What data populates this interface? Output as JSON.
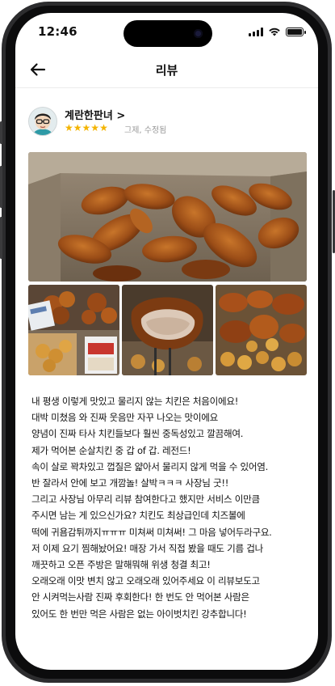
{
  "status_bar": {
    "time": "12:46"
  },
  "header": {
    "title": "리뷰",
    "back_icon": "arrow-left-icon"
  },
  "author": {
    "name": "계란한판녀 >",
    "rating": 5,
    "meta": "그제, 수정됨"
  },
  "photos": {
    "count": 4
  },
  "colors": {
    "star": "#f4b400",
    "text": "#111111",
    "muted": "#999999"
  },
  "review": {
    "lines": [
      "내 평생 이렇게 맛있고 물리지 않는 치킨은 처음이에요!",
      "대박 미쳤음 와 진짜 웃음만 자꾸 나오는 맛이에요",
      "양념이 진짜 타사 치킨들보다 훨씬 중독성있고 깔끔해여.",
      "제가 먹어본 순살치킨 중 갑 of 갑. 레전드!",
      "속이 살로 꽉차있고 껍질은 얇아서 물리지 않게 먹을 수 있어염.",
      "반 잘라서 안에 보고 개깜놀! 살박ㅋㅋㅋ 사장님 굿!!",
      "그리고 사장님 아무리 리뷰 참여한다고 했지만 서비스 이만큼",
      "주시면 남는 게 있으신가요? 치킨도 최상급인데 치즈볼에",
      "떡에 귀욤감튀까지ㅠㅠㅠ 미쳐써 미쳐써! 그 마음 넣어두라구요.",
      "저 이제 요기 찜해놨어요! 매장 가서 직접 봤을 때도 기름 겁나",
      "깨끗하고 오픈 주방은 말해뭐해 위생 청결 최고!",
      "오래오래 이맛 변치 않고 오래오래 있어주세요 이 리뷰보도고",
      "안 시켜먹는사람 진짜 후회한다! 한 번도 안 먹어본 사람은",
      "있어도 한 번만 먹은 사람은 없는 아이벗치킨 강추합니다!"
    ]
  }
}
